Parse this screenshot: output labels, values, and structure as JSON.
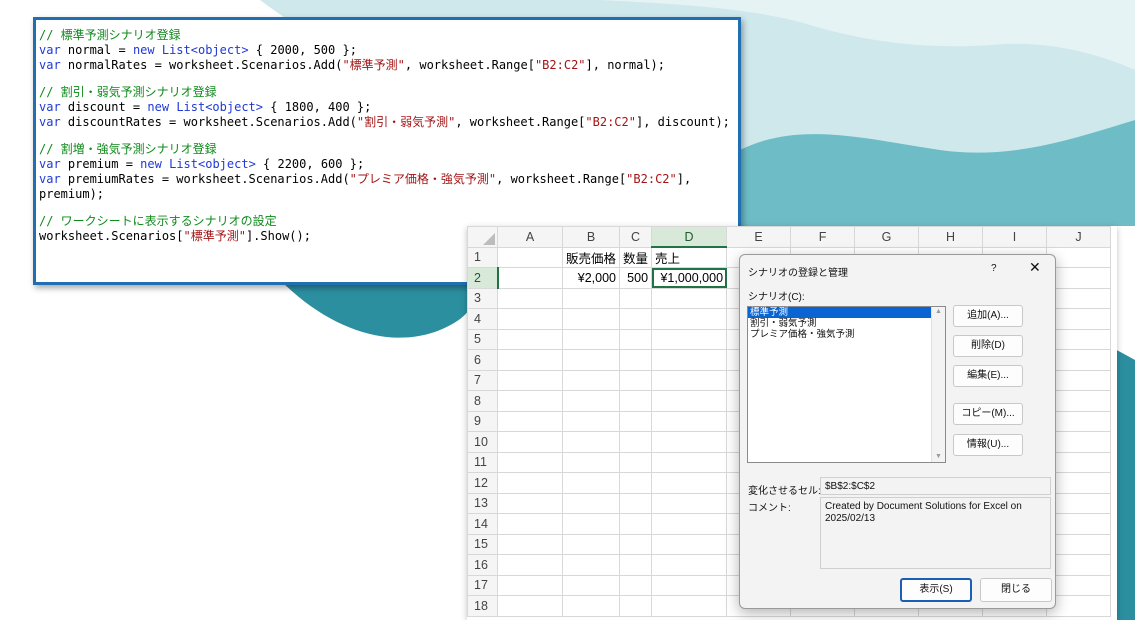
{
  "code": {
    "blocks": [
      [
        [
          {
            "t": "c",
            "s": "// 標準予測シナリオ登録"
          }
        ],
        [
          {
            "t": "k",
            "s": "var"
          },
          {
            "t": "p",
            "s": " normal = "
          },
          {
            "t": "k",
            "s": "new"
          },
          {
            "t": "p",
            "s": " "
          },
          {
            "t": "k",
            "s": "List<object>"
          },
          {
            "t": "p",
            "s": " { 2000, 500 };"
          }
        ],
        [
          {
            "t": "k",
            "s": "var"
          },
          {
            "t": "p",
            "s": " normalRates = worksheet.Scenarios.Add("
          },
          {
            "t": "s",
            "s": "\"標準予測\""
          },
          {
            "t": "p",
            "s": ", worksheet.Range["
          },
          {
            "t": "s",
            "s": "\"B2:C2\""
          },
          {
            "t": "p",
            "s": "], normal);"
          }
        ]
      ],
      [
        [
          {
            "t": "c",
            "s": "// 割引・弱気予測シナリオ登録"
          }
        ],
        [
          {
            "t": "k",
            "s": "var"
          },
          {
            "t": "p",
            "s": " discount = "
          },
          {
            "t": "k",
            "s": "new"
          },
          {
            "t": "p",
            "s": " "
          },
          {
            "t": "k",
            "s": "List<object>"
          },
          {
            "t": "p",
            "s": " { 1800, 400 };"
          }
        ],
        [
          {
            "t": "k",
            "s": "var"
          },
          {
            "t": "p",
            "s": " discountRates = worksheet.Scenarios.Add("
          },
          {
            "t": "s",
            "s": "\"割引・弱気予測\""
          },
          {
            "t": "p",
            "s": ", worksheet.Range["
          },
          {
            "t": "s",
            "s": "\"B2:C2\""
          },
          {
            "t": "p",
            "s": "], discount);"
          }
        ]
      ],
      [
        [
          {
            "t": "c",
            "s": "// 割増・強気予測シナリオ登録"
          }
        ],
        [
          {
            "t": "k",
            "s": "var"
          },
          {
            "t": "p",
            "s": " premium = "
          },
          {
            "t": "k",
            "s": "new"
          },
          {
            "t": "p",
            "s": " "
          },
          {
            "t": "k",
            "s": "List<object>"
          },
          {
            "t": "p",
            "s": " { 2200, 600 };"
          }
        ],
        [
          {
            "t": "k",
            "s": "var"
          },
          {
            "t": "p",
            "s": " premiumRates = worksheet.Scenarios.Add("
          },
          {
            "t": "s",
            "s": "\"プレミア価格・強気予測\""
          },
          {
            "t": "p",
            "s": ", worksheet.Range["
          },
          {
            "t": "s",
            "s": "\"B2:C2\""
          },
          {
            "t": "p",
            "s": "],"
          }
        ],
        [
          {
            "t": "p",
            "s": "premium);"
          }
        ]
      ],
      [
        [
          {
            "t": "c",
            "s": "// ワークシートに表示するシナリオの設定"
          }
        ],
        [
          {
            "t": "p",
            "s": "worksheet.Scenarios["
          },
          {
            "t": "s",
            "s": "\"標準予測\""
          },
          {
            "t": "p",
            "s": "].Show();"
          }
        ]
      ]
    ]
  },
  "sheet": {
    "columns": [
      "A",
      "B",
      "C",
      "D",
      "E",
      "F",
      "G",
      "H",
      "I",
      "J"
    ],
    "row_numbers": [
      "1",
      "2",
      "3",
      "4",
      "5",
      "6",
      "7",
      "8",
      "9",
      "10",
      "11",
      "12",
      "13",
      "14",
      "15",
      "16",
      "17",
      "18"
    ],
    "b1": "販売価格",
    "c1": "数量",
    "d1": "売上",
    "b2": "¥2,000",
    "c2": "500",
    "d2": "¥1,000,000"
  },
  "dialog": {
    "title": "シナリオの登録と管理",
    "help": "?",
    "close": "✕",
    "scenario_label": "シナリオ(C):",
    "scenarios": [
      "標準予測",
      "割引・弱気予測",
      "プレミア価格・強気予測"
    ],
    "buttons": {
      "add": "追加(A)...",
      "delete": "削除(D)",
      "edit": "編集(E)...",
      "copy": "コピー(M)...",
      "info": "情報(U)..."
    },
    "changing_cells_label": "変化させるセル:",
    "changing_cells_value": "$B$2:$C$2",
    "comment_label": "コメント:",
    "comment_value": "Created by Document Solutions for Excel on 2025/02/13",
    "show": "表示(S)",
    "close_button": "閉じる"
  },
  "colors": {
    "accent": "#1f6fb2",
    "wave_light": "#a9d5dc",
    "wave_mid": "#4ba6b4",
    "wave_dark": "#2b8fa0",
    "selection": "#0a64d2",
    "excel_green": "#217346"
  }
}
